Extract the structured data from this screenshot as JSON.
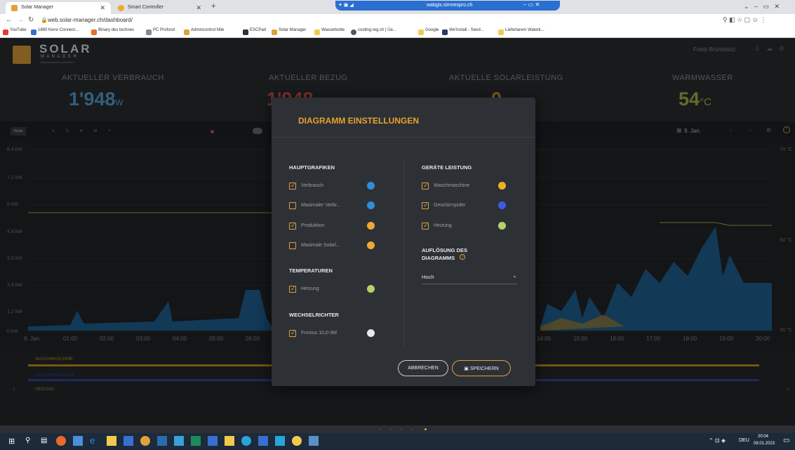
{
  "browser": {
    "tabs": [
      {
        "label": "Solar Manager",
        "active": true
      },
      {
        "label": "Smart Controller",
        "active": false
      }
    ],
    "new_tab": "+",
    "url": "web.solar-manager.ch/dashboard/",
    "remote_title": "wabgix.simnespro.ch",
    "bookmarks": [
      "YouTube",
      "1880 Keno Connect...",
      "Binary des technes",
      "PC Profond",
      "Admincontrol Nite",
      "ESCPad",
      "Solar Manager",
      "Wasserkotte",
      "cooling.reg.ch | Üe...",
      "Google",
      "We'install - Send...",
      "Liefertarem Waterk..."
    ]
  },
  "app": {
    "logo_main": "SOLAR",
    "logo_sub": "M A N A G E R",
    "logo_tag": "Eigenverbrauch optimieren",
    "user_name": "Fredy Brünishotz",
    "metrics": [
      {
        "label": "AKTUELLER VERBRAUCH",
        "value": "1'948",
        "unit": "w",
        "color": "#5aa3d8"
      },
      {
        "label": "AKTUELLER BEZUG",
        "value": "1'948",
        "unit": "w",
        "color": "#d9544a"
      },
      {
        "label": "AKTUELLE SOLARLEISTUNG",
        "value": "0",
        "unit": "w",
        "color": "#e0a03a"
      },
      {
        "label": "WARMWASSER",
        "value": "54",
        "unit": "°C",
        "color": "#a9b84a"
      }
    ],
    "toolbar": {
      "today": "Heute",
      "periods": [
        "h",
        "D",
        "W",
        "M",
        "Y"
      ],
      "date": "9. Jan.",
      "prev": "‹",
      "next": "›"
    },
    "chart": {
      "y_left": [
        "8.4 kW",
        "7.2 kW",
        "6 kW",
        "4.8 kW",
        "3.6 kW",
        "2.4 kW",
        "1.2 kW",
        "0 kW"
      ],
      "y_right": [
        "70 °C",
        "50 °C",
        "30 °C"
      ],
      "x_ticks": [
        "9. Jan.",
        "01:00",
        "02:00",
        "03:00",
        "04:00",
        "05:00",
        "06:00",
        "14:00",
        "15:00",
        "16:00",
        "17:00",
        "18:00",
        "19:00",
        "20:00"
      ]
    },
    "devices": [
      {
        "name": "WASCHMASCHINE",
        "color": "#c49a1e"
      },
      {
        "name": "GESCHIRRSPÜLER",
        "color": "#3a46a8"
      },
      {
        "name": "HEIZUNG",
        "color": "#8aa04a"
      }
    ]
  },
  "modal": {
    "title": "DIAGRAMM EINSTELLUNGEN",
    "title_color": "#e8a12b",
    "left": {
      "hauptgrafiken": {
        "heading": "HAUPTGRAFIKEN",
        "items": [
          {
            "label": "Verbrauch",
            "checked": true,
            "color": "#2e8fd9"
          },
          {
            "label": "Maximaler Verbr...",
            "checked": false,
            "color": "#2e8fd9"
          },
          {
            "label": "Produktion",
            "checked": true,
            "color": "#f0a830"
          },
          {
            "label": "Maximale Solarl...",
            "checked": false,
            "color": "#f0a830"
          }
        ]
      },
      "temperaturen": {
        "heading": "TEMPERATUREN",
        "items": [
          {
            "label": "Heizung",
            "checked": true,
            "color": "#b6d06a"
          }
        ]
      },
      "wechselrichter": {
        "heading": "WECHSELRICHTER",
        "items": [
          {
            "label": "Fronius 10,0-3M",
            "checked": true,
            "color": "#e8e8e8"
          }
        ]
      }
    },
    "right": {
      "geraete": {
        "heading": "GERÄTE LEISTUNG",
        "items": [
          {
            "label": "Waschmaschine",
            "checked": true,
            "color": "#f0b020"
          },
          {
            "label": "Geschirrspüler",
            "checked": true,
            "color": "#3b5ee0"
          },
          {
            "label": "Heizung",
            "checked": true,
            "color": "#b6d06a"
          }
        ]
      },
      "aufloesung": {
        "heading_1": "AUFLÖSUNG DES",
        "heading_2": "DIAGRAMMS",
        "value": "Hoch"
      }
    },
    "cancel": "ABBRECHEN",
    "save": "SPEICHERN"
  },
  "taskbar": {
    "lang": "DEU",
    "time": "20:04",
    "date": "09.01.2023"
  }
}
